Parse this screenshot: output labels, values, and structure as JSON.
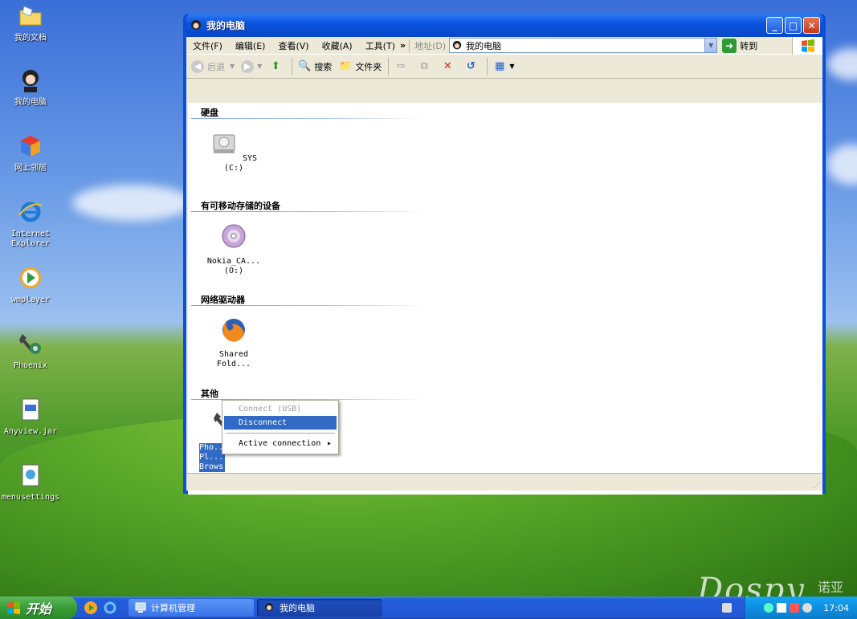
{
  "desktop": {
    "icons": [
      {
        "label": "我的文档"
      },
      {
        "label": "我的电脑"
      },
      {
        "label": "网上邻居"
      },
      {
        "label": "Internet Explorer"
      },
      {
        "label": "wmplayer"
      },
      {
        "label": "Phoenix"
      },
      {
        "label": "Anyview.jar"
      },
      {
        "label": "menusettings"
      }
    ]
  },
  "window": {
    "title": "我的电脑",
    "menu": [
      "文件(F)",
      "编辑(E)",
      "查看(V)",
      "收藏(A)",
      "工具(T)"
    ],
    "menu_more": "»",
    "address_label": "地址(D)",
    "address_value": "我的电脑",
    "goto_label": "转到",
    "toolbar": {
      "back": "后退",
      "search": "搜索",
      "folders": "文件夹"
    },
    "groups": [
      {
        "title": "硬盘",
        "items": [
          {
            "label": "SYS (C:)"
          }
        ]
      },
      {
        "title": "有可移动存储的设备",
        "items": [
          {
            "label": "Nokia_CA...(O:)"
          }
        ]
      },
      {
        "title": "网络驱动器",
        "items": [
          {
            "label": "Shared Fold..."
          }
        ]
      },
      {
        "title": "其他",
        "items": [
          {
            "label": "Phoenix PC Browser",
            "label_visible": "Pho... Pl... Brows..."
          }
        ]
      }
    ]
  },
  "context_menu": {
    "items": [
      {
        "label": "Connect (USB)",
        "state": "disabled"
      },
      {
        "label": "Disconnect",
        "state": "highlighted"
      },
      {
        "label": "Active connection",
        "state": "submenu"
      }
    ]
  },
  "taskbar": {
    "start_label": "开始",
    "tasks": [
      {
        "label": "计算机管理"
      },
      {
        "label": "我的电脑"
      }
    ],
    "clock": "17:04"
  },
  "watermark": {
    "text": "Dospy",
    "cn": "诺亚"
  }
}
